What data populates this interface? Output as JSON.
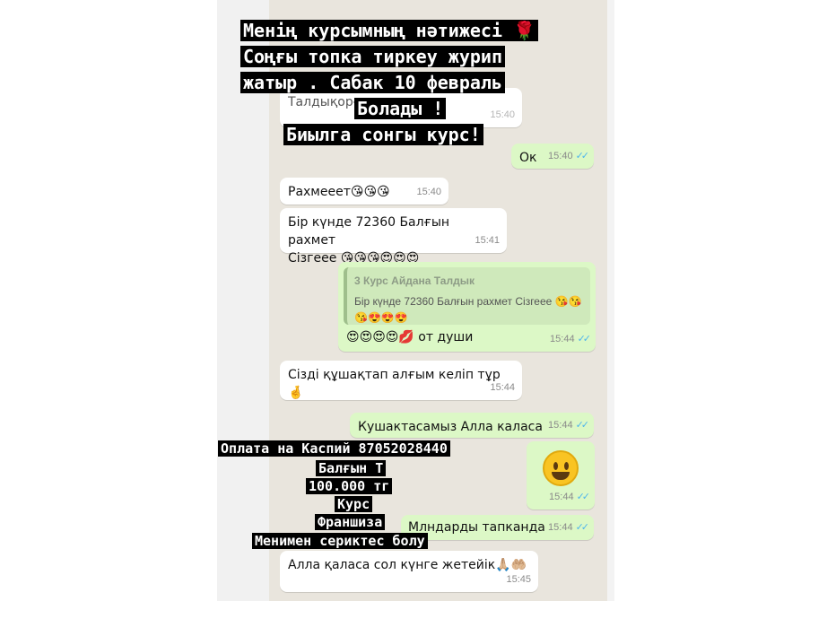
{
  "overlay_top": [
    "Менің курсымның нәтижесі",
    "Соңғы топка тиркеу журип",
    "жатыр . Сабак 10 февраль",
    "Болады !",
    "Биылга сонгы курс!"
  ],
  "overlay_bottom": [
    "Оплата на Каспий 87052028440",
    "Балғын Т",
    "100.000 тг",
    "Курс",
    "Франшиза",
    "Менимен сериктес болу"
  ],
  "icons": {
    "rose": "rose-icon",
    "read_receipt": "double-check-icon",
    "smiley": "grinning-face-icon"
  },
  "colors": {
    "incoming": "#ffffff",
    "outgoing": "#dcf8c6",
    "tick": "#4fb6ec",
    "chat_bg": "#e9e5dd"
  },
  "messages": {
    "m0": {
      "text": "Талдықорға",
      "time": "15:40"
    },
    "m1": {
      "text": "Ок",
      "time": "15:40"
    },
    "m2": {
      "text": "Рахмееет😘😘😘",
      "time": "15:40"
    },
    "m3": {
      "line1": "Бір күнде 72360 Балғын рахмет",
      "line2": "Сізгеее 😘😘😘😍😍😍",
      "time": "15:41"
    },
    "m4": {
      "quote_author": "3 Курс Айдана Талдык",
      "quote_line1": "Бір күнде 72360 Балғын рахмет Сізгеее 😘😘",
      "quote_line2": "😘😍😍😍",
      "text": "😍😍😍😍💋 от души",
      "time": "15:44"
    },
    "m5": {
      "text": "Сізді құшақтап алғым келіп тұр 🤞",
      "time": "15:44"
    },
    "m6": {
      "text": "Кушактасамыз Алла каласа",
      "time": "15:44"
    },
    "m7": {
      "time": "15:44"
    },
    "m8": {
      "text": "Млндарды тапканда",
      "time": "15:44"
    },
    "m9": {
      "text": "Алла қаласа сол күнге жетейік🙏🏼🤲🏼",
      "time": "15:45"
    }
  }
}
